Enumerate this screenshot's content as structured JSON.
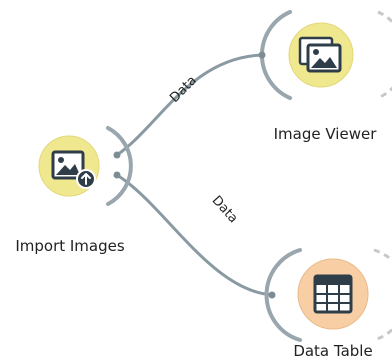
{
  "nodes": {
    "import_images": {
      "label": "Import Images",
      "icon": "image-upload-icon",
      "fill": "#f0e88f"
    },
    "image_viewer": {
      "label": "Image Viewer",
      "icon": "image-stack-icon",
      "fill": "#f0e88f"
    },
    "data_table": {
      "label": "Data Table",
      "icon": "table-grid-icon",
      "fill": "#f8cfa4"
    }
  },
  "links": [
    {
      "label": "Data",
      "from": "Import Images",
      "to": "Image Viewer"
    },
    {
      "label": "Data",
      "from": "Import Images",
      "to": "Data Table"
    }
  ],
  "colors": {
    "link": "#8a9aa2",
    "port_arc": "#9aa6ad",
    "dashed_arc": "#c8c8c8"
  }
}
